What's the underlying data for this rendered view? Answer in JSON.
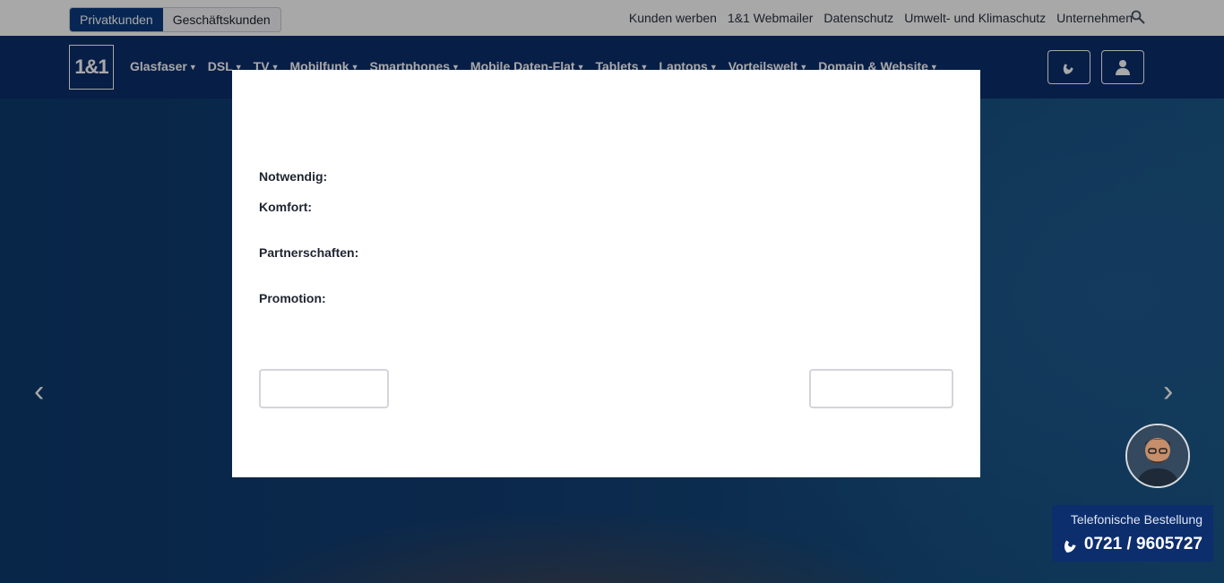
{
  "segment": {
    "private_label": "Privatkunden",
    "business_label": "Geschäftskunden"
  },
  "toplinks": [
    "Kunden werben",
    "1&1 Webmailer",
    "Datenschutz",
    "Umwelt- und Klimaschutz",
    "Unternehmen"
  ],
  "logo": {
    "text": "1&1"
  },
  "nav": {
    "items": [
      "Glasfaser",
      "DSL",
      "TV",
      "Mobilfunk",
      "Smartphones",
      "Mobile Daten-Flat",
      "Tablets",
      "Laptops",
      "Vorteilswelt",
      "Domain & Website"
    ]
  },
  "modal": {
    "labels": {
      "necessary": "Notwendig:",
      "comfort": "Komfort:",
      "partnerships": "Partnerschaften:",
      "promotion": "Promotion:"
    }
  },
  "phone": {
    "title": "Telefonische Bestellung",
    "number": "0721 / 9605727"
  },
  "colors": {
    "brand_navy": "#0c2e6d",
    "active_segment": "#0b3a7e"
  },
  "icons": {
    "search": "search-icon",
    "phone": "phone-icon",
    "user": "user-icon",
    "chevron": "chevron-down-icon",
    "carousel_prev": "chevron-left-icon",
    "carousel_next": "chevron-right-icon"
  }
}
